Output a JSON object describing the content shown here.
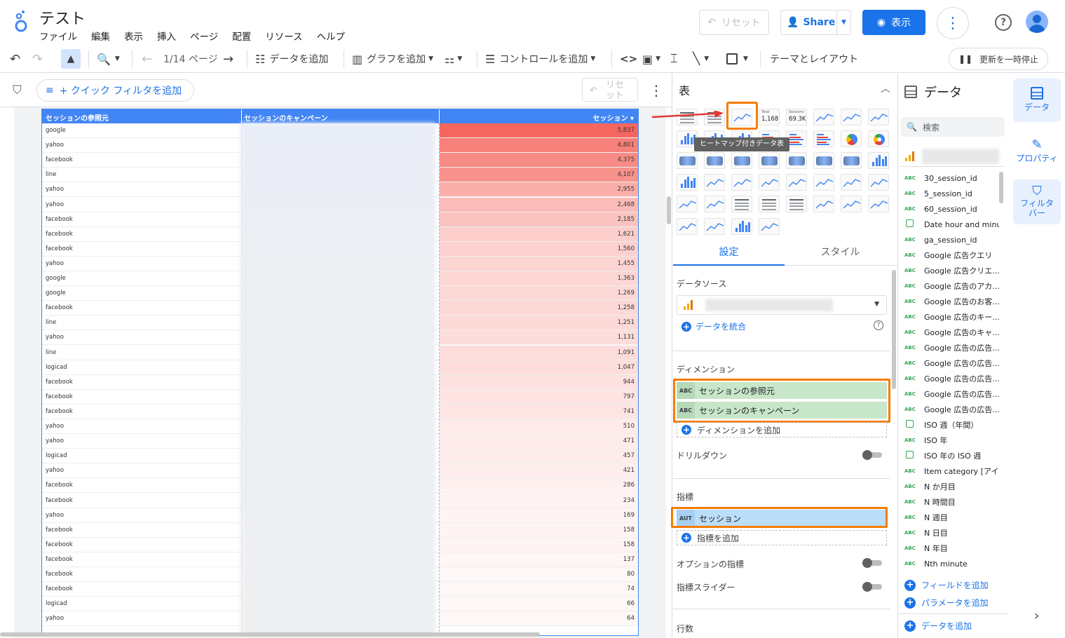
{
  "header": {
    "title": "テスト",
    "menu": [
      "ファイル",
      "編集",
      "表示",
      "挿入",
      "ページ",
      "配置",
      "リソース",
      "ヘルプ"
    ],
    "reset_label": "リセット",
    "share_label": "Share",
    "view_label": "表示"
  },
  "toolbar": {
    "page_indicator": "1/14 ページ",
    "add_data": "データを追加",
    "add_chart": "グラフを追加",
    "add_control": "コントロールを追加",
    "theme_layout": "テーマとレイアウト",
    "pause_updates": "更新を一時停止"
  },
  "canvas": {
    "quick_filter": "+ クイック フィルタを追加",
    "reset": "リセット"
  },
  "table": {
    "headers": [
      "セッションの参照元",
      "セッションのキャンペーン",
      "セッション"
    ],
    "rows": [
      {
        "source": "google",
        "sessions": "5,837",
        "level": 1.0
      },
      {
        "source": "yahoo",
        "sessions": "4,801",
        "level": 0.82
      },
      {
        "source": "facebook",
        "sessions": "4,375",
        "level": 0.75
      },
      {
        "source": "line",
        "sessions": "4,107",
        "level": 0.7
      },
      {
        "source": "yahoo",
        "sessions": "2,955",
        "level": 0.51
      },
      {
        "source": "yahoo",
        "sessions": "2,468",
        "level": 0.42
      },
      {
        "source": "facebook",
        "sessions": "2,185",
        "level": 0.37
      },
      {
        "source": "facebook",
        "sessions": "1,621",
        "level": 0.28
      },
      {
        "source": "facebook",
        "sessions": "1,560",
        "level": 0.27
      },
      {
        "source": "yahoo",
        "sessions": "1,455",
        "level": 0.25
      },
      {
        "source": "google",
        "sessions": "1,363",
        "level": 0.23
      },
      {
        "source": "google",
        "sessions": "1,269",
        "level": 0.22
      },
      {
        "source": "facebook",
        "sessions": "1,258",
        "level": 0.22
      },
      {
        "source": "line",
        "sessions": "1,251",
        "level": 0.21
      },
      {
        "source": "yahoo",
        "sessions": "1,131",
        "level": 0.19
      },
      {
        "source": "line",
        "sessions": "1,091",
        "level": 0.19
      },
      {
        "source": "logicad",
        "sessions": "1,047",
        "level": 0.18
      },
      {
        "source": "facebook",
        "sessions": "944",
        "level": 0.16
      },
      {
        "source": "facebook",
        "sessions": "797",
        "level": 0.14
      },
      {
        "source": "facebook",
        "sessions": "741",
        "level": 0.13
      },
      {
        "source": "yahoo",
        "sessions": "510",
        "level": 0.09
      },
      {
        "source": "yahoo",
        "sessions": "471",
        "level": 0.08
      },
      {
        "source": "logicad",
        "sessions": "457",
        "level": 0.08
      },
      {
        "source": "yahoo",
        "sessions": "421",
        "level": 0.07
      },
      {
        "source": "facebook",
        "sessions": "286",
        "level": 0.05
      },
      {
        "source": "facebook",
        "sessions": "234",
        "level": 0.04
      },
      {
        "source": "yahoo",
        "sessions": "169",
        "level": 0.03
      },
      {
        "source": "facebook",
        "sessions": "158",
        "level": 0.03
      },
      {
        "source": "facebook",
        "sessions": "158",
        "level": 0.03
      },
      {
        "source": "facebook",
        "sessions": "137",
        "level": 0.02
      },
      {
        "source": "facebook",
        "sessions": "80",
        "level": 0.01
      },
      {
        "source": "facebook",
        "sessions": "74",
        "level": 0.01
      },
      {
        "source": "logicad",
        "sessions": "66",
        "level": 0.01
      },
      {
        "source": "yahoo",
        "sessions": "64",
        "level": 0.01
      }
    ]
  },
  "chart_picker": {
    "title": "表",
    "scorecard_total": "1,168",
    "scorecard_total_label": "Total",
    "scorecard_sessions": "69.3K",
    "scorecard_sessions_label": "Sessions",
    "tooltip": "ヒートマップ付きデータ表"
  },
  "setup": {
    "tab_setup": "設定",
    "tab_style": "スタイル",
    "datasource_label": "データソース",
    "blend_label": "データを統合",
    "dimension_label": "ディメンション",
    "dimensions": [
      {
        "type": "ABC",
        "name": "セッションの参照元"
      },
      {
        "type": "ABC",
        "name": "セッションのキャンペーン"
      }
    ],
    "add_dimension": "ディメンションを追加",
    "drilldown": "ドリルダウン",
    "metric_label": "指標",
    "metrics": [
      {
        "type": "AUT",
        "name": "セッション"
      }
    ],
    "add_metric": "指標を追加",
    "optional_metric": "オプションの指標",
    "metric_slider": "指標スライダー",
    "rows_label": "行数"
  },
  "data_panel": {
    "title": "データ",
    "search_placeholder": "検索",
    "fields": [
      {
        "type": "ABC",
        "name": "30_session_id"
      },
      {
        "type": "ABC",
        "name": "5_session_id"
      },
      {
        "type": "ABC",
        "name": "60_session_id"
      },
      {
        "type": "CAL",
        "name": "Date hour and minute"
      },
      {
        "type": "ABC",
        "name": "ga_session_id"
      },
      {
        "type": "ABC",
        "name": "Google 広告クエリ"
      },
      {
        "type": "ABC",
        "name": "Google 広告クリエ..."
      },
      {
        "type": "ABC",
        "name": "Google 広告のアカ..."
      },
      {
        "type": "ABC",
        "name": "Google 広告のお客..."
      },
      {
        "type": "ABC",
        "name": "Google 広告のキー..."
      },
      {
        "type": "ABC",
        "name": "Google 広告のキャ..."
      },
      {
        "type": "ABC",
        "name": "Google 広告の広告..."
      },
      {
        "type": "ABC",
        "name": "Google 広告の広告..."
      },
      {
        "type": "ABC",
        "name": "Google 広告の広告..."
      },
      {
        "type": "ABC",
        "name": "Google 広告の広告..."
      },
      {
        "type": "ABC",
        "name": "Google 広告の広告..."
      },
      {
        "type": "CAL",
        "name": "ISO 週（年間）"
      },
      {
        "type": "ABC",
        "name": "ISO 年"
      },
      {
        "type": "CAL",
        "name": "ISO 年の ISO 週"
      },
      {
        "type": "ABC",
        "name": "Item category [アイ..."
      },
      {
        "type": "ABC",
        "name": "N か月目"
      },
      {
        "type": "ABC",
        "name": "N 時間目"
      },
      {
        "type": "ABC",
        "name": "N 週目"
      },
      {
        "type": "ABC",
        "name": "N 日目"
      },
      {
        "type": "ABC",
        "name": "N 年目"
      },
      {
        "type": "ABC",
        "name": "Nth minute"
      }
    ],
    "add_field": "フィールドを追加",
    "add_parameter": "パラメータを追加",
    "add_data": "データを追加"
  },
  "rail": {
    "data": "データ",
    "properties": "プロパティ",
    "filter": "フィルタバー"
  },
  "colors": {
    "accent": "#1a73e8",
    "highlight": "#f57c00",
    "heat": "#f4564d"
  }
}
